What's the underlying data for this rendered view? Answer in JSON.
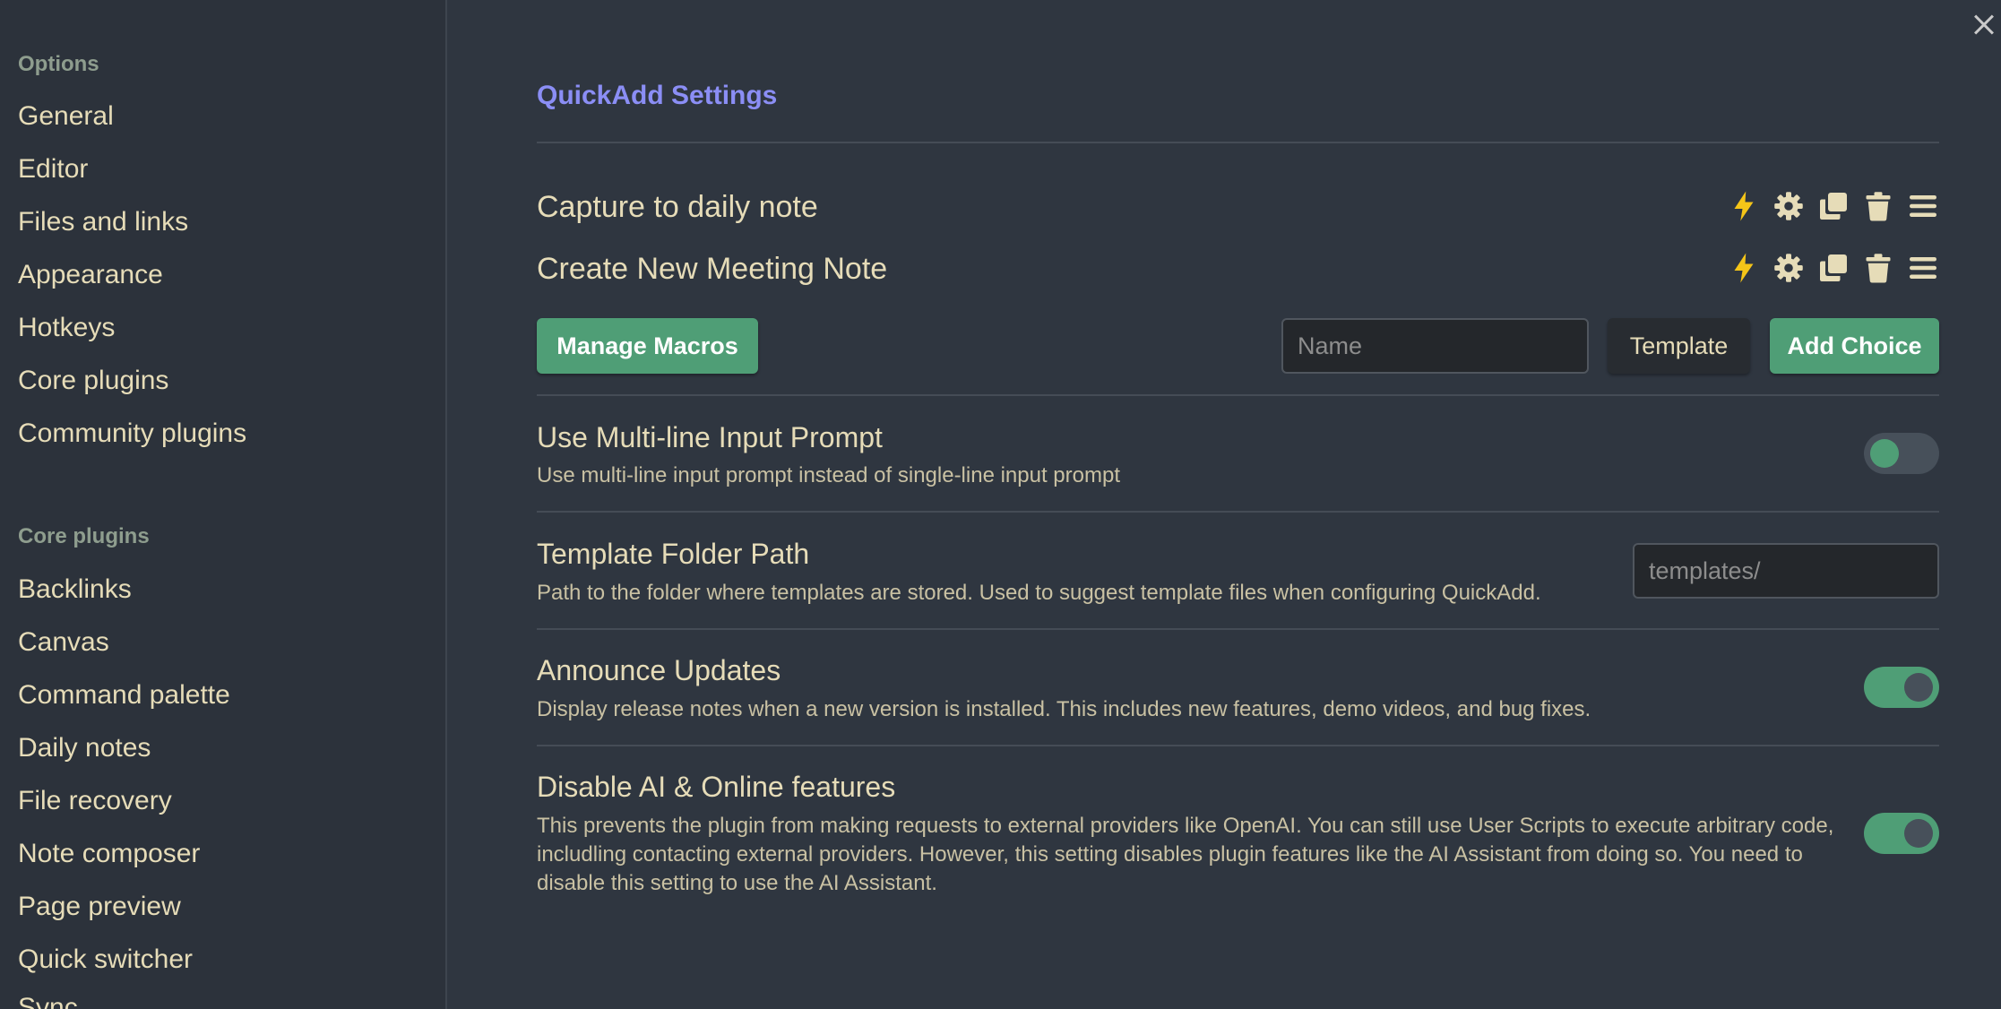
{
  "sidebar": {
    "options_heading": "Options",
    "options_items": [
      {
        "label": "General"
      },
      {
        "label": "Editor"
      },
      {
        "label": "Files and links"
      },
      {
        "label": "Appearance"
      },
      {
        "label": "Hotkeys"
      },
      {
        "label": "Core plugins"
      },
      {
        "label": "Community plugins"
      }
    ],
    "core_heading": "Core plugins",
    "core_items": [
      {
        "label": "Backlinks"
      },
      {
        "label": "Canvas"
      },
      {
        "label": "Command palette"
      },
      {
        "label": "Daily notes"
      },
      {
        "label": "File recovery"
      },
      {
        "label": "Note composer"
      },
      {
        "label": "Page preview"
      },
      {
        "label": "Quick switcher"
      },
      {
        "label": "Sync"
      }
    ]
  },
  "main": {
    "title": "QuickAdd Settings",
    "choices": [
      {
        "name": "Capture to daily note"
      },
      {
        "name": "Create New Meeting Note"
      }
    ],
    "choice_icons": [
      "lightning-icon",
      "gear-icon",
      "duplicate-icon",
      "trash-icon",
      "drag-handle-icon"
    ],
    "manage_macros_label": "Manage Macros",
    "name_placeholder": "Name",
    "template_label": "Template",
    "add_choice_label": "Add Choice",
    "settings": [
      {
        "name": "Use Multi-line Input Prompt",
        "desc": "Use multi-line input prompt instead of single-line input prompt",
        "enabled": false
      },
      {
        "name": "Template Folder Path",
        "desc": "Path to the folder where templates are stored. Used to suggest template files when configuring QuickAdd.",
        "placeholder": "templates/"
      },
      {
        "name": "Announce Updates",
        "desc": "Display release notes when a new version is installed. This includes new features, demo videos, and bug fixes.",
        "enabled": true
      },
      {
        "name": "Disable AI & Online features",
        "desc": "This prevents the plugin from making requests to external providers like OpenAI. You can still use User Scripts to execute arbitrary code, includling contacting external providers. However, this setting disables plugin features like the AI Assistant from doing so. You need to disable this setting to use the AI Assistant.",
        "enabled": true
      }
    ]
  },
  "colors": {
    "accent": "#8b8ef5",
    "green": "#4f9e76",
    "lightning": "#f5c518",
    "text": "#e6dcb8"
  }
}
